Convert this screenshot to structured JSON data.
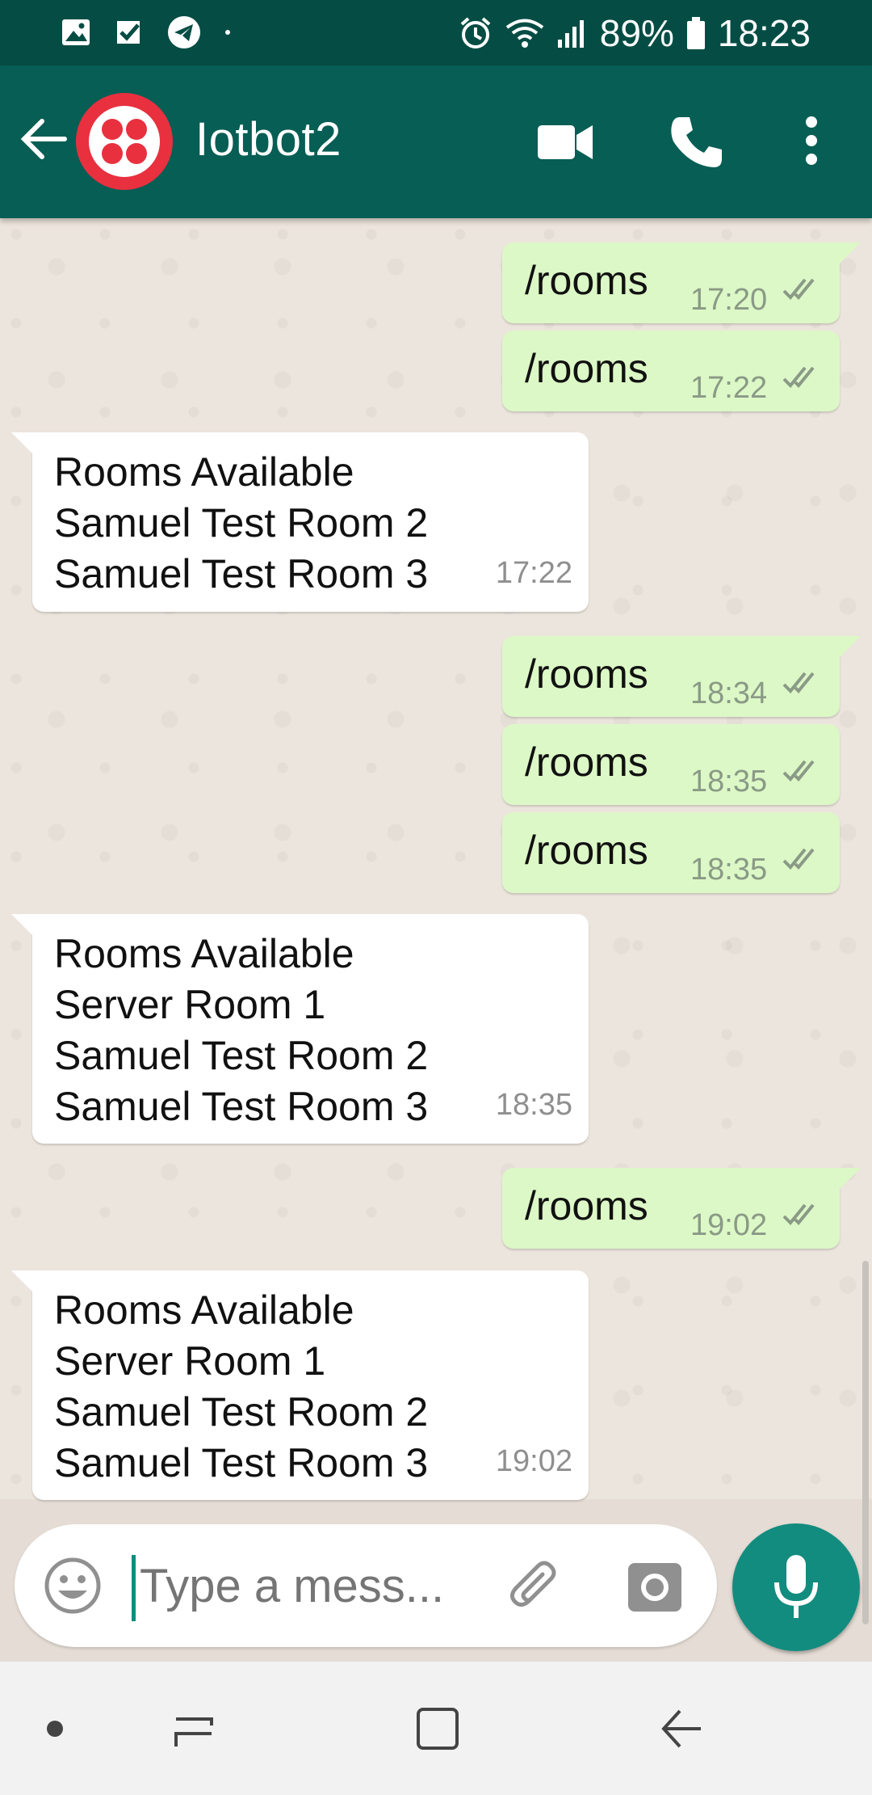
{
  "status_bar": {
    "battery": "89%",
    "time": "18:23"
  },
  "header": {
    "contact_name": "Iotbot2"
  },
  "messages": [
    {
      "dir": "out",
      "text": "/rooms",
      "time": "17:20"
    },
    {
      "dir": "out",
      "text": "/rooms",
      "time": "17:22"
    },
    {
      "dir": "in",
      "lines": [
        "Rooms Available",
        "Samuel Test Room 2",
        "Samuel Test Room 3"
      ],
      "time": "17:22"
    },
    {
      "dir": "out",
      "text": "/rooms",
      "time": "18:34"
    },
    {
      "dir": "out",
      "text": "/rooms",
      "time": "18:35"
    },
    {
      "dir": "out",
      "text": "/rooms",
      "time": "18:35"
    },
    {
      "dir": "in",
      "lines": [
        "Rooms Available",
        "Server Room 1",
        "Samuel Test Room 2",
        "Samuel Test Room 3"
      ],
      "time": "18:35"
    },
    {
      "dir": "out",
      "text": "/rooms",
      "time": "19:02"
    },
    {
      "dir": "in",
      "lines": [
        "Rooms Available",
        "Server Room 1",
        "Samuel Test Room 2",
        "Samuel Test Room 3"
      ],
      "time": "19:02"
    }
  ],
  "composer": {
    "placeholder": "Type a mess..."
  },
  "colors": {
    "status_bar": "#054d44",
    "app_bar": "#075e54",
    "outgoing_bubble": "#dcf8c6",
    "incoming_bubble": "#ffffff",
    "mic_button": "#128c7e",
    "avatar": "#e8303f"
  },
  "icons": [
    "image-icon",
    "check-app-icon",
    "telegram-icon",
    "alarm-icon",
    "wifi-icon",
    "signal-icon",
    "battery-icon",
    "back-arrow-icon",
    "video-call-icon",
    "phone-icon",
    "more-vert-icon",
    "emoji-icon",
    "attach-icon",
    "camera-icon",
    "mic-icon"
  ]
}
